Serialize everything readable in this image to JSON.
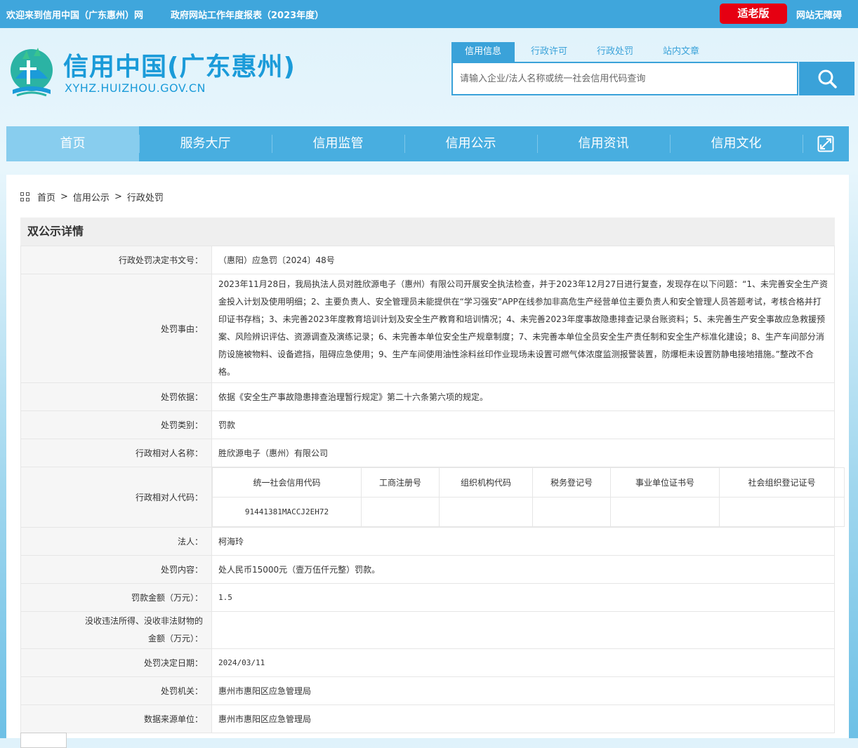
{
  "topbar": {
    "welcome": "欢迎来到信用中国（广东惠州）网",
    "report": "政府网站工作年度报表（2023年度）",
    "elder_mode": "适老版",
    "accessibility": "网站无障碍"
  },
  "header": {
    "logo_title": "信用中国(广东惠州)",
    "logo_url": "XYHZ.HUIZHOU.GOV.CN",
    "search_tabs": [
      "信用信息",
      "行政许可",
      "行政处罚",
      "站内文章"
    ],
    "search_placeholder": "请输入企业/法人名称或统一社会信用代码查询"
  },
  "nav": {
    "items": [
      "首页",
      "服务大厅",
      "信用监管",
      "信用公示",
      "信用资讯",
      "信用文化"
    ],
    "active": "首页"
  },
  "breadcrumb": [
    "首页",
    "信用公示",
    "行政处罚"
  ],
  "detail": {
    "heading": "双公示详情",
    "rows": {
      "doc_no": {
        "label": "行政处罚决定书文号：",
        "value": "（惠阳）应急罚〔2024〕48号"
      },
      "reason": {
        "label": "处罚事由：",
        "value": "2023年11月28日，我局执法人员对胜欣源电子（惠州）有限公司开展安全执法检查，并于2023年12月27日进行复查，发现存在以下问题：“1、未完善安全生产资金投入计划及使用明细；2、主要负责人、安全管理员未能提供在“学习强安”APP在线参加非高危生产经营单位主要负责人和安全管理人员答题考试，考核合格并打印证书存档；3、未完善2023年度教育培训计划及安全生产教育和培训情况；4、未完善2023年度事故隐患排查记录台账资料；5、未完善生产安全事故应急救援预案、风险辨识评估、资源调查及演练记录；6、未完善本单位安全生产规章制度；7、未完善本单位全员安全生产责任制和安全生产标准化建设；8、生产车间部分消防设施被物料、设备遮挡，阻碍应急使用；9、生产车间使用油性涂料丝印作业现场未设置可燃气体浓度监测报警装置，防爆柜未设置防静电接地措施。”整改不合格。"
      },
      "basis": {
        "label": "处罚依据：",
        "value": "依据《安全生产事故隐患排查治理暂行规定》第二十六条第六项的规定。"
      },
      "category": {
        "label": "处罚类别：",
        "value": "罚款"
      },
      "party_name": {
        "label": "行政相对人名称：",
        "value": "胜欣源电子（惠州）有限公司"
      },
      "party_code": {
        "label": "行政相对人代码：",
        "headers": [
          "统一社会信用代码",
          "工商注册号",
          "组织机构代码",
          "税务登记号",
          "事业单位证书号",
          "社会组织登记证号"
        ],
        "values": [
          "91441381MACCJ2EH72",
          "",
          "",
          "",
          "",
          ""
        ]
      },
      "legal_person": {
        "label": "法人：",
        "value": "柯海玲"
      },
      "content": {
        "label": "处罚内容：",
        "value": "处人民币15000元（壹万伍仟元整）罚款。"
      },
      "amount": {
        "label": "罚款金额（万元）：",
        "value": "1.5"
      },
      "confiscation": {
        "label_line1": "没收违法所得、没收非法财物的",
        "label_line2": "金额（万元）：",
        "value": ""
      },
      "date": {
        "label": "处罚决定日期：",
        "value": "2024/03/11"
      },
      "authority": {
        "label": "处罚机关：",
        "value": "惠州市惠阳区应急管理局"
      },
      "source": {
        "label": "数据来源单位：",
        "value": "惠州市惠阳区应急管理局"
      }
    }
  },
  "colors": {
    "topbar": "#3fa6dc",
    "brand_blue": "#1b9bd9",
    "nav": "#48aee0",
    "nav_active": "#88cdee",
    "elder_red": "#e60012"
  }
}
